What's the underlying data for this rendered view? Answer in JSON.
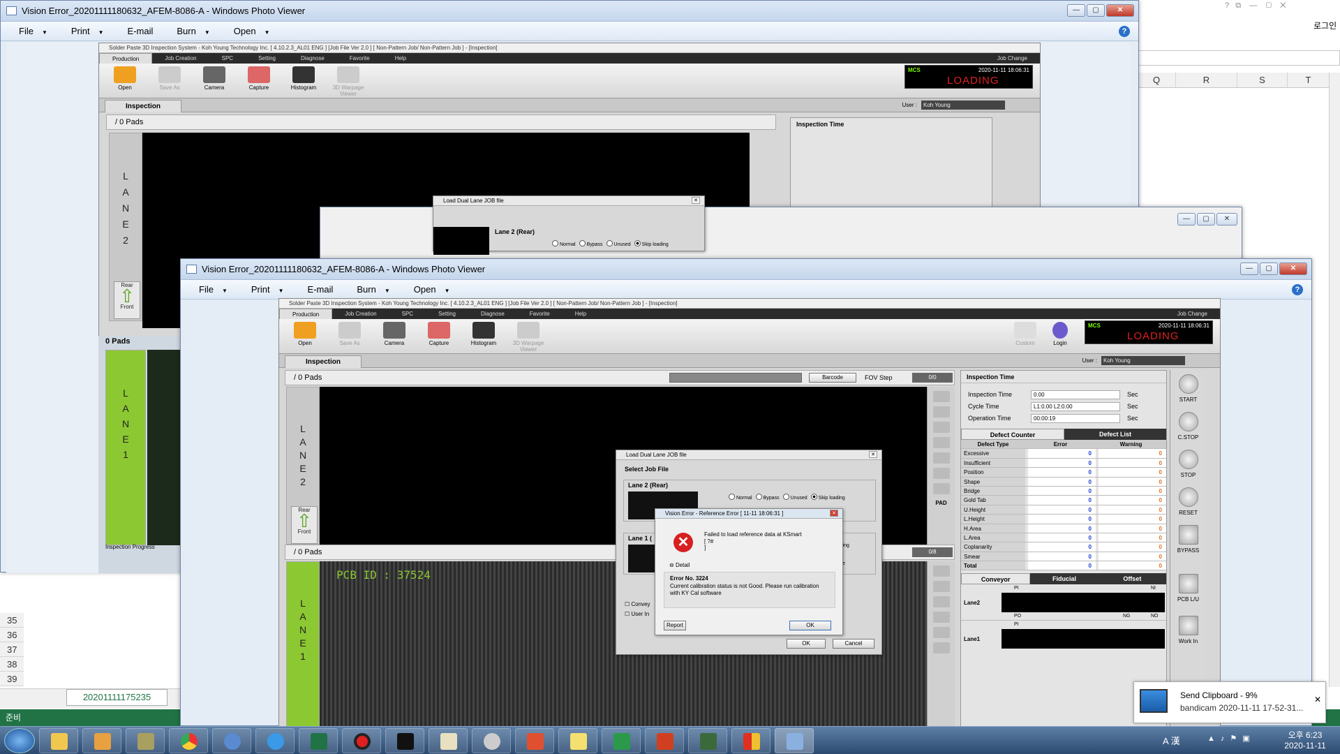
{
  "excel": {
    "columns": [
      "Q",
      "R",
      "S",
      "T"
    ],
    "rows": [
      "35",
      "36",
      "37",
      "38",
      "39"
    ],
    "sheet_tab": "20201111175235",
    "status": "준비",
    "login": "로그인"
  },
  "pv_back": {
    "title": "Vision Error_20201111180632_AFEM-8086-A - Windows Photo Viewer",
    "menu": [
      "File",
      "Print",
      "E-mail",
      "Burn",
      "Open"
    ],
    "inner_pads": "0 Pads"
  },
  "pv_front": {
    "title": "Vision Error_20201111180632_AFEM-8086-A - Windows Photo Viewer",
    "menu": [
      "File",
      "Print",
      "E-mail",
      "Burn",
      "Open"
    ]
  },
  "ky": {
    "title": "Solder Paste 3D Inspection System - Koh Young Technology Inc. [ 4.10.2.3_AL01 ENG ] [Job File Ver 2.0 ] [ Non-Pattern Job/ Non-Pattern Job ] - [Inspection]",
    "tabs": [
      "Production",
      "Job Creation",
      "SPC",
      "Setting",
      "Diagnose",
      "Favorite",
      "Help"
    ],
    "job_change": "Job Change",
    "toolbar": [
      "Open",
      "Save As",
      "Camera",
      "Capture",
      "Histogram",
      "3D Warpage Viewer"
    ],
    "custom": "Custom",
    "login": "Login",
    "mcs": "MCS",
    "mcs_datetime": "2020-11-11  18:06:31",
    "mcs_status": "LOADING",
    "sub_tab": "Inspection",
    "user_label": "User :",
    "user": "Koh Young",
    "pads_top": "/ 0 Pads",
    "pads_bottom": "/ 0 Pads",
    "barcode": "Barcode",
    "fov_step": "FOV Step",
    "fov_value": "0/0",
    "fov_value2": "0/8",
    "lane2_letters": [
      "L",
      "A",
      "N",
      "E",
      "2"
    ],
    "lane1_letters": [
      "L",
      "A",
      "N",
      "E",
      "1"
    ],
    "rear": "Rear",
    "front": "Front",
    "pcb_id": "PCB ID : 37524",
    "inspection_progress": "Inspection Progress",
    "insp_time_header": "Inspection Time",
    "insp_rows": [
      {
        "label": "Inspection Time",
        "value": "0.00",
        "unit": "Sec"
      },
      {
        "label": "Cycle Time",
        "value": "L1:0.00 L2:0.00",
        "unit": "Sec"
      },
      {
        "label": "Operation Time",
        "value": "00:00:19",
        "unit": "Sec"
      }
    ],
    "defect_tabs": [
      "Defect Counter",
      "Defect List"
    ],
    "defect_cols": [
      "Defect Type",
      "Error",
      "Warning"
    ],
    "defects": [
      {
        "name": "Excessive",
        "e": "0",
        "w": "0"
      },
      {
        "name": "Insufficient",
        "e": "0",
        "w": "0"
      },
      {
        "name": "Position",
        "e": "0",
        "w": "0"
      },
      {
        "name": "Shape",
        "e": "0",
        "w": "0"
      },
      {
        "name": "Bridge",
        "e": "0",
        "w": "0"
      },
      {
        "name": "Gold Tab",
        "e": "0",
        "w": "0"
      },
      {
        "name": "U.Height",
        "e": "0",
        "w": "0"
      },
      {
        "name": "L.Height",
        "e": "0",
        "w": "0"
      },
      {
        "name": "H.Area",
        "e": "0",
        "w": "0"
      },
      {
        "name": "L.Area",
        "e": "0",
        "w": "0"
      },
      {
        "name": "Coplanarity",
        "e": "0",
        "w": "0"
      },
      {
        "name": "Smear",
        "e": "0",
        "w": "0"
      },
      {
        "name": "Total",
        "e": "0",
        "w": "0"
      }
    ],
    "conv_tabs": [
      "Conveyor",
      "Fiducial",
      "Offset"
    ],
    "conv_lanes": [
      "Lane2",
      "Lane1"
    ],
    "conv_pi": "PI",
    "conv_po": "PO",
    "conv_ni": "NI",
    "conv_ng": "NG",
    "conv_no": "NO",
    "side": [
      "START",
      "C.STOP",
      "STOP",
      "RESET",
      "BYPASS",
      "PCB L/U",
      "Work In"
    ],
    "pad": "PAD"
  },
  "load_dlg": {
    "title": "Load Dual Lane JOB file",
    "select": "Select Job File",
    "lane2": "Lane 2 (Rear)",
    "lane1": "Lane 1 (",
    "options": [
      "Normal",
      "Bypass",
      "Unused",
      "Skip loading"
    ],
    "loading": "Loading",
    "mode": "gleMode",
    "conveyor": "Convey",
    "user_in": "User In",
    "ok": "OK",
    "cancel": "Cancel"
  },
  "err_dlg": {
    "title": "Vision Error - Reference Error [ 11-11 18:06:31 ]",
    "message": "Failed to load reference data at KSmart",
    "message2": "[ ?#",
    "message3": "]",
    "detail": "Detail",
    "error_no": "Error No. 3224",
    "detail_text": "Current calibration status is not Good. Please run calibration with KY Cal software",
    "report": "Report",
    "ok": "OK"
  },
  "toast": {
    "title": "Send Clipboard - 9%",
    "body": "bandicam 2020-11-11 17-52-31..."
  },
  "tray": {
    "time": "오후 6:23",
    "date": "2020-11-11",
    "ime": "A 漢"
  },
  "colors": {
    "lane_green": "#8cc832",
    "loading_red": "#e02020",
    "mcs_green": "#7cfc00"
  }
}
